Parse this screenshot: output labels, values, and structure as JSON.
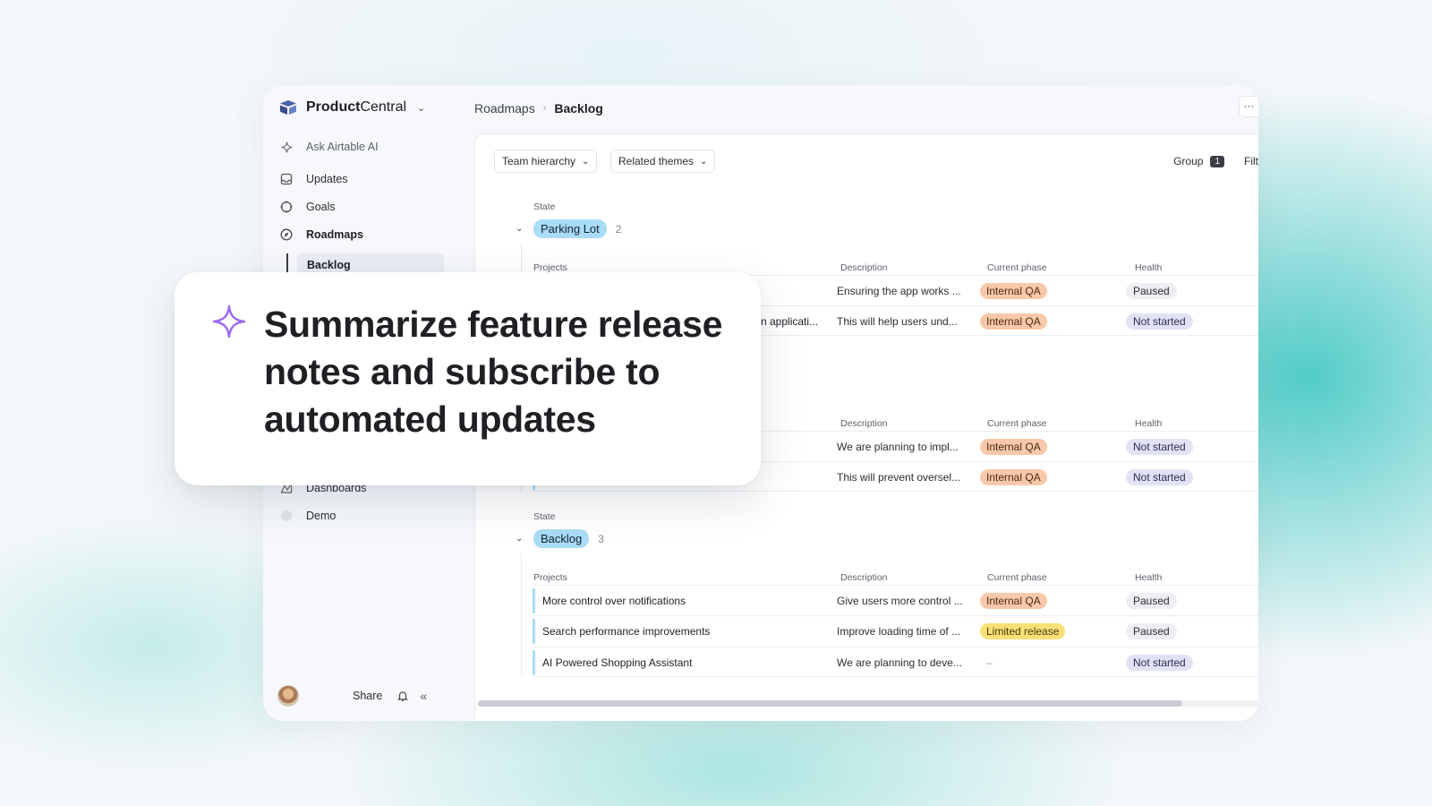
{
  "app": {
    "brand_bold": "Product",
    "brand_rest": "Central"
  },
  "sidebar": {
    "ask_ai": "Ask Airtable AI",
    "items": [
      {
        "label": "Updates",
        "icon": "inbox-icon"
      },
      {
        "label": "Goals",
        "icon": "target-icon"
      },
      {
        "label": "Roadmaps",
        "icon": "compass-icon"
      }
    ],
    "sub_item": "Backlog",
    "lower_items": [
      {
        "label": "Dashboards",
        "icon": "dashboard-icon"
      },
      {
        "label": "Demo",
        "icon": "blank-circle-icon"
      }
    ],
    "footer": {
      "share": "Share"
    }
  },
  "breadcrumb": {
    "parent": "Roadmaps",
    "current": "Backlog"
  },
  "toolbar": {
    "more": "···",
    "filters": [
      "Team hierarchy",
      "Related themes"
    ],
    "group_label": "Group",
    "group_count": "1",
    "filter_label": "Filt"
  },
  "table": {
    "state_label": "State",
    "columns": {
      "projects": "Projects",
      "description": "Description",
      "phase": "Current phase",
      "health": "Health"
    },
    "groups": [
      {
        "state": "Parking Lot",
        "count": "2",
        "rows": [
          {
            "project": "",
            "description": "Ensuring the app works ...",
            "phase": "Internal QA",
            "health": "Paused"
          },
          {
            "project": "n applicati...",
            "description": "This will help users und...",
            "phase": "Internal QA",
            "health": "Not started"
          }
        ]
      },
      {
        "state": "",
        "count": "",
        "rows": [
          {
            "project": "",
            "description": "We are planning to impl...",
            "phase": "Internal QA",
            "health": "Not started"
          },
          {
            "project": "",
            "description": "This will prevent oversel...",
            "phase": "Internal QA",
            "health": "Not started"
          }
        ]
      },
      {
        "state": "Backlog",
        "count": "3",
        "rows": [
          {
            "project": "More control over notifications",
            "description": "Give users more control ...",
            "phase": "Internal QA",
            "health": "Paused"
          },
          {
            "project": "Search performance improvements",
            "description": "Improve loading time of ...",
            "phase": "Limited release",
            "health": "Paused"
          },
          {
            "project": "AI Powered Shopping Assistant",
            "description": "We are planning to deve...",
            "phase": "–",
            "health": "Not started"
          }
        ]
      }
    ]
  },
  "callout": {
    "text": "Summarize feature release notes and subscribe to automated updates"
  },
  "colors": {
    "state_pill": "#a9dcf6",
    "internal_qa": "#f8c9a8",
    "limited_release": "#fbe07a",
    "paused": "#eeeff2",
    "not_started": "#e2e2f6",
    "ai_sparkle": "#8b5cf6"
  }
}
